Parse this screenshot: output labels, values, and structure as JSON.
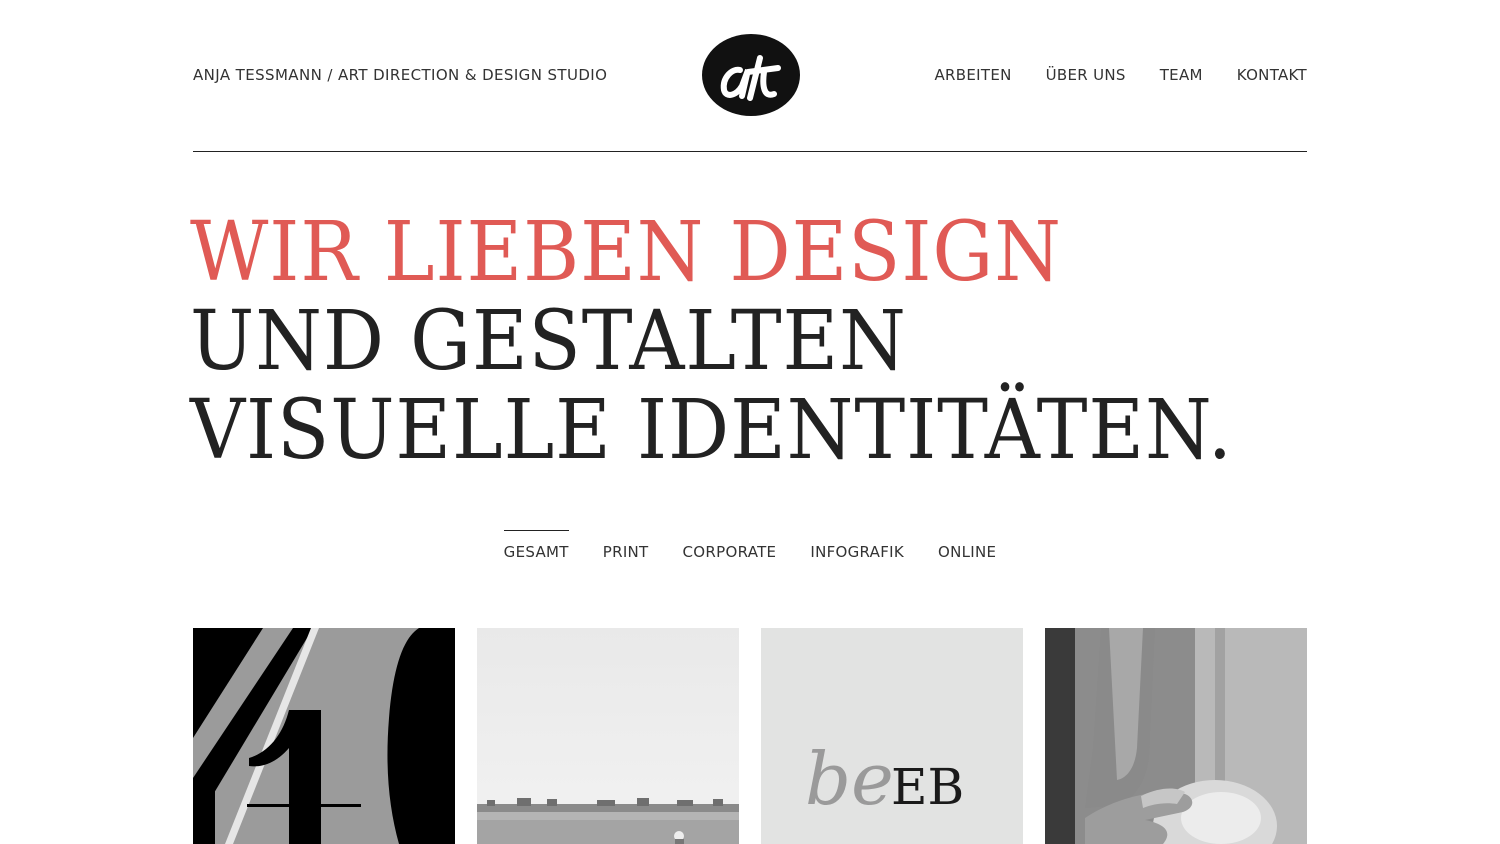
{
  "header": {
    "studio_name": "ANJA TESSMANN / ART DIRECTION & DESIGN STUDIO",
    "logo": "at-monogram-logo",
    "nav": [
      "ARBEITEN",
      "ÜBER UNS",
      "TEAM",
      "KONTAKT"
    ]
  },
  "hero": {
    "line1": "WIR LIEBEN DESIGN",
    "line2": "UND GESTALTEN",
    "line3": "VISUELLE IDENTITÄTEN."
  },
  "filters": {
    "items": [
      "GESAMT",
      "PRINT",
      "CORPORATE",
      "INFOGRAFIK",
      "ONLINE"
    ],
    "active": "GESAMT"
  },
  "portfolio": {
    "tiles": [
      {
        "name": "typography-40-image"
      },
      {
        "name": "landscape-photo"
      },
      {
        "name": "beeb-logo-image",
        "logo_text_script": "be",
        "logo_text_serif": "EB"
      },
      {
        "name": "hands-photo"
      }
    ]
  },
  "colors": {
    "accent": "#e05a55",
    "text": "#222222",
    "background": "#ffffff"
  }
}
